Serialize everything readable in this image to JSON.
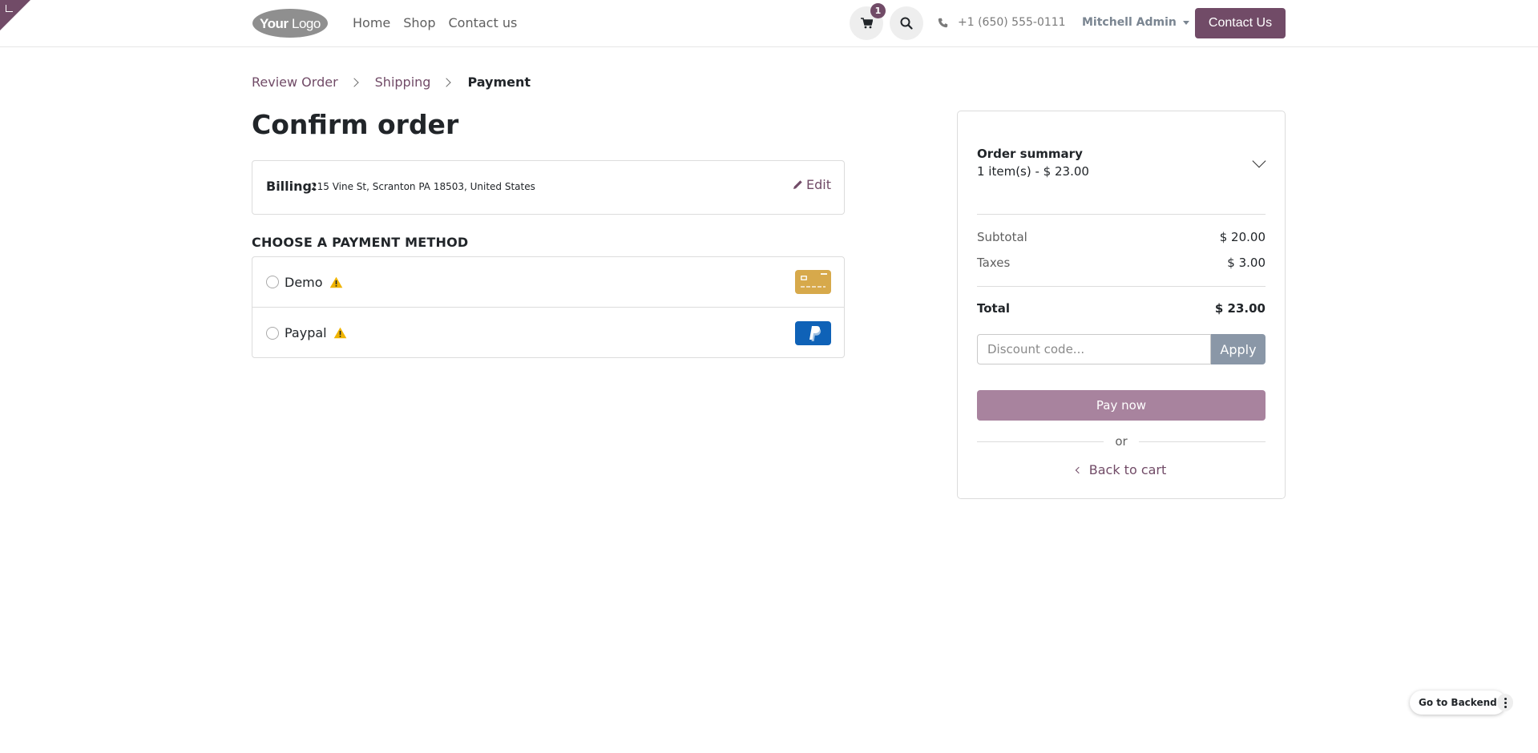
{
  "header": {
    "logo_text": "YourLogo",
    "nav": [
      "Home",
      "Shop",
      "Contact us"
    ],
    "cart_count": "1",
    "phone": "+1 (650) 555-0111",
    "user": "Mitchell Admin",
    "contact_button": "Contact Us"
  },
  "breadcrumb": {
    "items": [
      "Review Order",
      "Shipping",
      "Payment"
    ]
  },
  "page_title": "Confirm order",
  "billing": {
    "label": "Billing:",
    "address": "215 Vine St, Scranton PA 18503, United States",
    "edit_label": "Edit"
  },
  "payment": {
    "heading": "CHOOSE A PAYMENT METHOD",
    "methods": [
      {
        "name": "Demo",
        "logo": "credit-card-icon",
        "color": "#d7a94b"
      },
      {
        "name": "Paypal",
        "logo": "paypal-icon",
        "color": "#0f62b7"
      }
    ]
  },
  "summary": {
    "title": "Order summary",
    "items_text": "1 item(s) -  $ 23.00",
    "subtotal_label": "Subtotal",
    "subtotal_value": "$ 20.00",
    "taxes_label": "Taxes",
    "taxes_value": "$ 3.00",
    "total_label": "Total",
    "total_value": "$ 23.00",
    "discount_placeholder": "Discount code...",
    "apply_label": "Apply",
    "pay_label": "Pay now",
    "or_label": "or",
    "back_label": "Back to cart"
  },
  "backend": {
    "label": "Go to Backend"
  },
  "colors": {
    "accent": "#714b67",
    "warning": "#f0b400"
  }
}
